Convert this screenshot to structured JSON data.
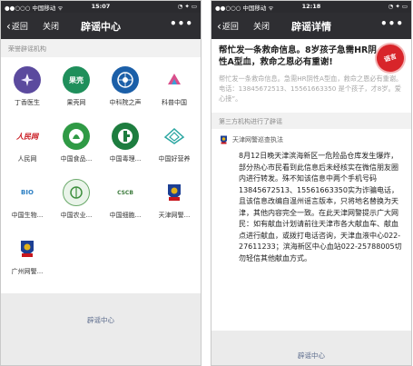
{
  "left": {
    "status": {
      "carrier": "●●○○○ 中国移动 ᯤ",
      "time": "15:07",
      "battery": "◔ ✦ ▭"
    },
    "nav": {
      "back": "返回",
      "close": "关闭",
      "title": "辟谣中心",
      "more": "•••"
    },
    "section_label": "荣誉辟谣机构",
    "orgs": [
      {
        "label": "丁香医生",
        "icon": "dingxiang-doctor-logo"
      },
      {
        "label": "果壳网",
        "icon": "guokr-logo",
        "logo_text": "果壳"
      },
      {
        "label": "中科院之声",
        "icon": "cas-voice-logo"
      },
      {
        "label": "科普中国",
        "icon": "kepu-china-logo"
      },
      {
        "label": "人民网",
        "icon": "peoples-daily-logo",
        "logo_text": "人民网"
      },
      {
        "label": "中国食品...",
        "icon": "china-food-logo"
      },
      {
        "label": "中国毒理...",
        "icon": "china-toxicology-logo"
      },
      {
        "label": "中国好营养",
        "icon": "china-nutrition-logo"
      },
      {
        "label": "中国生物...",
        "icon": "china-bio-logo",
        "logo_text": "BIO"
      },
      {
        "label": "中国农业...",
        "icon": "china-agri-logo"
      },
      {
        "label": "中国细胞...",
        "icon": "china-cell-logo",
        "logo_text": "CSCB"
      },
      {
        "label": "天津网警...",
        "icon": "tianjin-police-logo"
      },
      {
        "label": "广州网警...",
        "icon": "guangzhou-police-logo"
      }
    ],
    "footer_link": "辟谣中心"
  },
  "right": {
    "status": {
      "carrier": "●●○○○ 中国移动 ᯤ",
      "time": "12:18",
      "battery": "◔ ✦ ▭"
    },
    "nav": {
      "back": "返回",
      "close": "关闭",
      "title": "辟谣详情",
      "more": "•••"
    },
    "article_title": "帮忙发一条救命信息。8岁孩子急需HR阴性A型血，救命之恩必有重谢!",
    "stamp_text": "谣言",
    "article_quote": "帮忙发一条救命信息。急需HR阴性A型血，救命之恩必有重谢。电话：13845672513、15561663350 是个孩子，才8岁。爱心接”。",
    "divider_label": "第三方机构进行了辟谣",
    "source_name": "天津网警巡查执法",
    "article_body": "8月12日晚天津滨海新区一危险品仓库发生爆炸，部分热心市民看到此信息后未经核实在微信朋友圈内进行转发。殊不知该信息中两个手机号码13845672513、15561663350实为诈骗电话，且该信息改编自温州谣言版本，只将地名替换为天津，其他内容完全一致。在此天津网警提示广大网民：如有献血计划请前往天津市各大献血车、献血点进行献血，或拨打电话咨询，天津血液中心022-27611233；滨海新区中心血站022-25788005切勿轻信其他献血方式。",
    "footer_link": "辟谣中心"
  }
}
